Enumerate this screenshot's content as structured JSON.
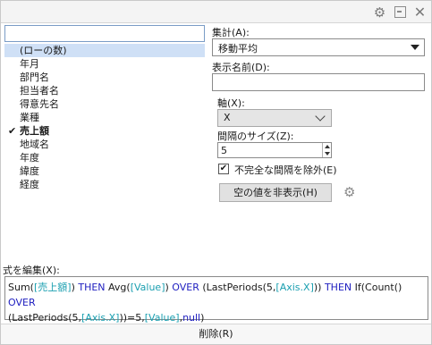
{
  "titlebar": {
    "gear_icon": "gear-icon",
    "popout_icon": "popout-icon",
    "close_icon": "close-icon"
  },
  "search": {
    "value": "",
    "placeholder": ""
  },
  "list": [
    {
      "label": "(ローの数)",
      "selected": true
    },
    {
      "label": "年月"
    },
    {
      "label": "部門名"
    },
    {
      "label": "担当者名"
    },
    {
      "label": "得意先名"
    },
    {
      "label": "業種"
    },
    {
      "label": "売上額",
      "checked": true,
      "bold": true
    },
    {
      "label": "地域名"
    },
    {
      "label": "年度"
    },
    {
      "label": "緯度"
    },
    {
      "label": "経度"
    }
  ],
  "aggregation": {
    "label": "集計(A):",
    "value": "移動平均"
  },
  "display_name": {
    "label": "表示名前(D):",
    "value": ""
  },
  "axis": {
    "label": "軸(X):",
    "value": "X"
  },
  "interval": {
    "label": "間隔のサイズ(Z):",
    "value": "5"
  },
  "exclude_incomplete": {
    "label": "不完全な間隔を除外(E)",
    "checked": true
  },
  "hide_empty_button": {
    "label": "空の値を非表示(H)"
  },
  "expression": {
    "label": "式を編集(X):",
    "t1": "Sum(",
    "t2": "[売上額]",
    "t3": ") ",
    "t4": "THEN",
    "t5": " Avg(",
    "t6": "[Value]",
    "t7": ") ",
    "t8": "OVER",
    "t9": " (LastPeriods(5,",
    "t10": "[Axis.X]",
    "t11": ")) ",
    "t12": "THEN",
    "t13": " If(Count() ",
    "t14": "OVER",
    "t15": "(LastPeriods(5,",
    "t16": "[Axis.X]",
    "t17": "))=5,",
    "t18": "[Value]",
    "t19": ",",
    "t20": "null",
    "t21": ")"
  },
  "delete_button": {
    "label": "削除(R)"
  }
}
